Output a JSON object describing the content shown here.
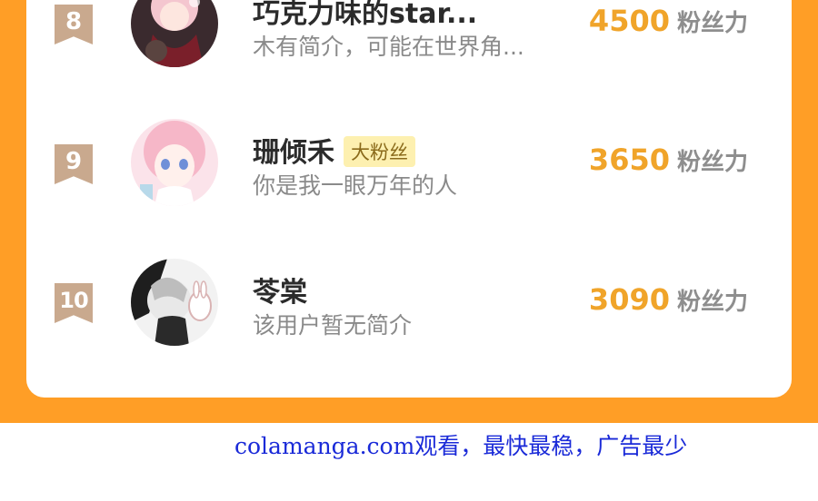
{
  "leaderboard": {
    "rows": [
      {
        "rank": "8",
        "name": "巧克力味的star...",
        "badge": "",
        "bio": "木有简介，可能在世界角...",
        "score": "4500",
        "unit": "粉丝力"
      },
      {
        "rank": "9",
        "name": "珊倾禾",
        "badge": "大粉丝",
        "bio": "你是我一眼万年的人",
        "score": "3650",
        "unit": "粉丝力"
      },
      {
        "rank": "10",
        "name": "苓棠",
        "badge": "",
        "bio": "该用户暂无简介",
        "score": "3090",
        "unit": "粉丝力"
      }
    ]
  },
  "watermark": "colamanga.com观看，最快最稳，广告最少",
  "colors": {
    "frame_orange": "#ff9e26",
    "score_orange": "#f0a42a",
    "rank_badge": "#c9a98e",
    "fan_tag_bg": "#fdf0b0"
  }
}
